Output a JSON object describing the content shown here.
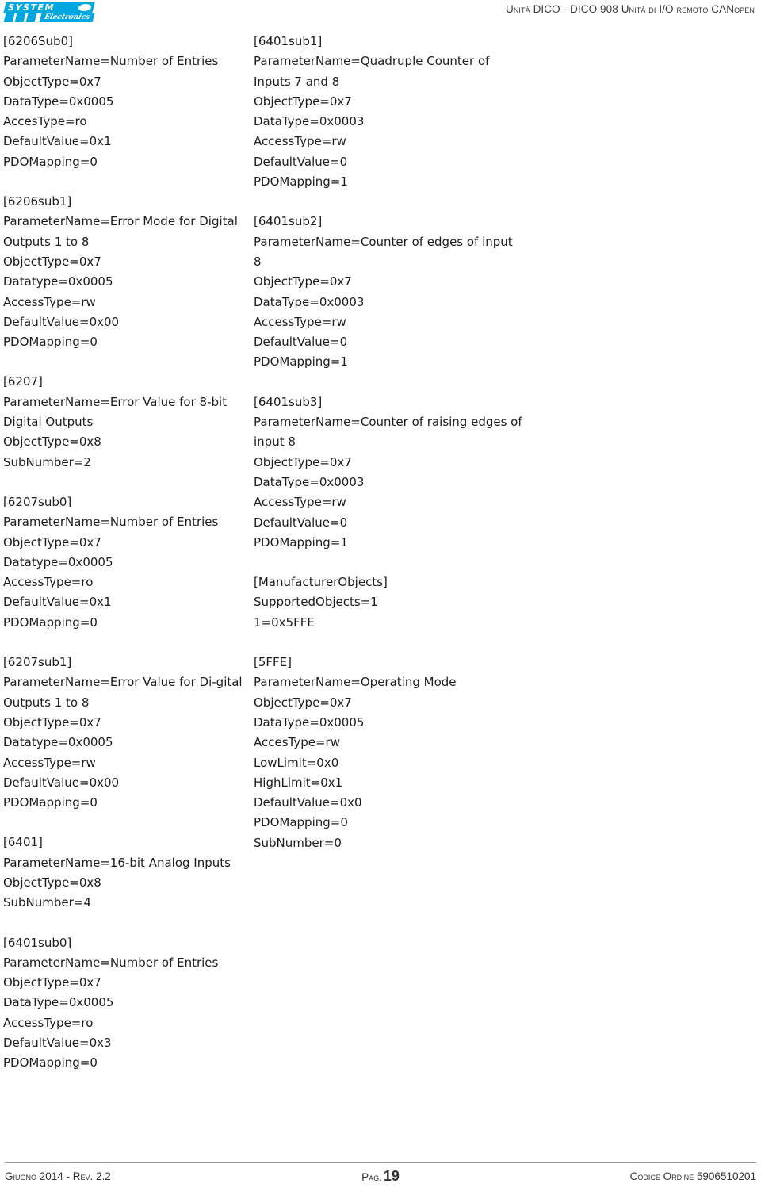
{
  "header": {
    "logo": {
      "line1": "SYSTEM",
      "line2": "Electronics",
      "color": "#00A7E1"
    },
    "title": "Unità DICO - DICO 908 Unità di I/O remoto CANopen"
  },
  "columns": {
    "left": [
      {
        "id": "6206Sub0",
        "lines": [
          "[6206Sub0]",
          "ParameterName=Number of Entries",
          "ObjectType=0x7",
          "DataType=0x0005",
          "AccesType=ro",
          "DefaultValue=0x1",
          "PDOMapping=0"
        ]
      },
      {
        "id": "6206sub1",
        "lines": [
          "[6206sub1]",
          "ParameterName=Error Mode for Digital Outputs 1 to 8",
          "ObjectType=0x7",
          "Datatype=0x0005",
          "AccessType=rw",
          "DefaultValue=0x00",
          "PDOMapping=0"
        ]
      },
      {
        "id": "6207",
        "lines": [
          "[6207]",
          "ParameterName=Error Value for 8-bit Digital Outputs",
          "ObjectType=0x8",
          "SubNumber=2"
        ]
      },
      {
        "id": "6207sub0",
        "lines": [
          "[6207sub0]",
          "ParameterName=Number of Entries",
          "ObjectType=0x7",
          "Datatype=0x0005",
          "AccessType=ro",
          "DefaultValue=0x1",
          "PDOMapping=0"
        ]
      },
      {
        "id": "6207sub1",
        "lines": [
          "[6207sub1]",
          "ParameterName=Error Value for Di-gital Outputs 1 to 8",
          "ObjectType=0x7",
          "Datatype=0x0005",
          "AccessType=rw",
          "DefaultValue=0x00",
          "PDOMapping=0"
        ]
      },
      {
        "id": "6401",
        "lines": [
          "[6401]",
          "ParameterName=16-bit Analog Inputs",
          "ObjectType=0x8",
          "SubNumber=4"
        ]
      },
      {
        "id": "6401sub0",
        "lines": [
          "[6401sub0]",
          "ParameterName=Number of Entries",
          "ObjectType=0x7",
          "DataType=0x0005",
          "AccessType=ro",
          "DefaultValue=0x3",
          "PDOMapping=0"
        ]
      }
    ],
    "right": [
      {
        "id": "6401sub1",
        "lines": [
          "[6401sub1]",
          "ParameterName=Quadruple Counter of Inputs 7 and 8",
          "ObjectType=0x7",
          "DataType=0x0003",
          "AccessType=rw",
          "DefaultValue=0",
          "PDOMapping=1"
        ]
      },
      {
        "id": "6401sub2",
        "lines": [
          "[6401sub2]",
          "ParameterName=Counter of edges of input 8",
          "ObjectType=0x7",
          "DataType=0x0003",
          "AccessType=rw",
          "DefaultValue=0",
          "PDOMapping=1"
        ]
      },
      {
        "id": "6401sub3",
        "lines": [
          "[6401sub3]",
          "ParameterName=Counter of raising edges of input 8",
          "ObjectType=0x7",
          "DataType=0x0003",
          "AccessType=rw",
          "DefaultValue=0",
          "PDOMapping=1"
        ]
      },
      {
        "id": "ManufacturerObjects",
        "lines": [
          "[ManufacturerObjects]",
          "SupportedObjects=1",
          "1=0x5FFE"
        ]
      },
      {
        "id": "5FFE",
        "lines": [
          "[5FFE]",
          "ParameterName=Operating Mode",
          "ObjectType=0x7",
          "DataType=0x0005",
          "AccesType=rw",
          "LowLimit=0x0",
          "HighLimit=0x1",
          "DefaultValue=0x0",
          "PDOMapping=0",
          "SubNumber=0"
        ]
      }
    ]
  },
  "footer": {
    "left": "Giugno 2014 - Rev. 2.2",
    "page_label": "Pag.",
    "page_number": "19",
    "right": "Codice Ordine 5906510201"
  }
}
